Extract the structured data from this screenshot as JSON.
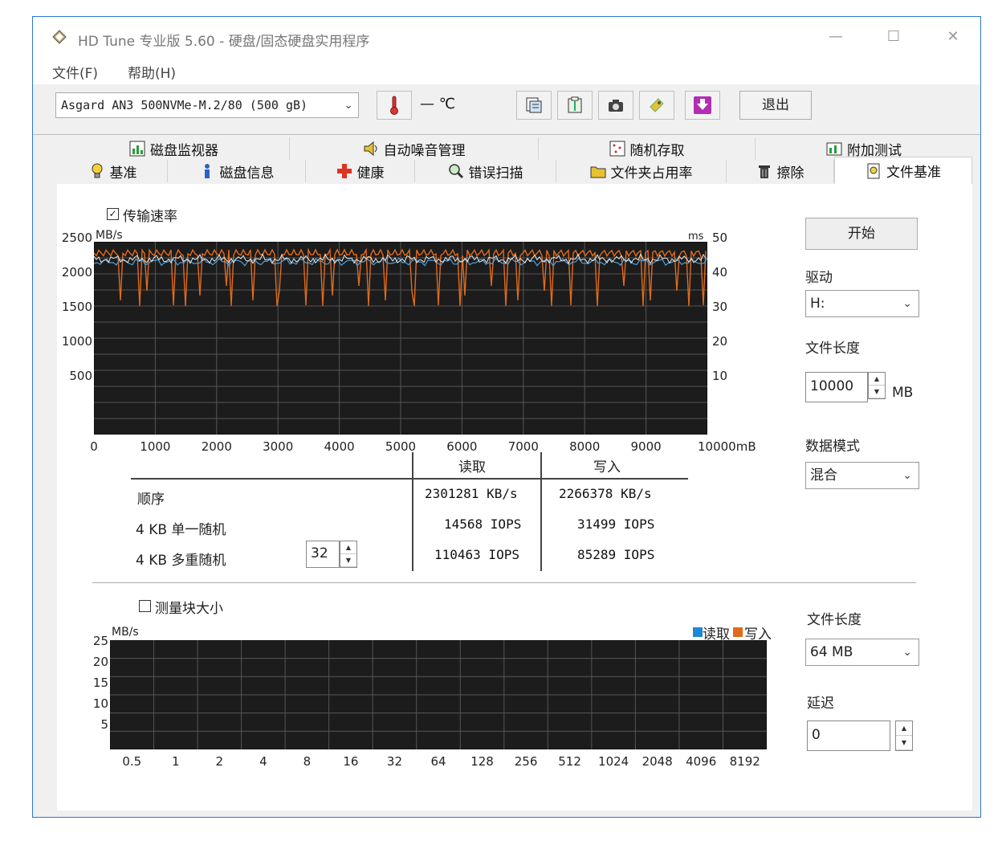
{
  "window": {
    "title": "HD Tune 专业版 5.60 - 硬盘/固态硬盘实用程序",
    "minimize": "—",
    "maximize": "☐",
    "close": "✕"
  },
  "menu": [
    "文件(F)",
    "帮助(H)"
  ],
  "toolbar": {
    "drive": "Asgard AN3 500NVMe-M.2/80 (500 gB)",
    "temperature": "— ℃",
    "exit_label": "退出"
  },
  "tabs_top": [
    "磁盘监视器",
    "自动噪音管理",
    "随机存取",
    "附加测试"
  ],
  "tabs_bottom": [
    "基准",
    "磁盘信息",
    "健康",
    "错误扫描",
    "文件夹占用率",
    "擦除",
    "文件基准"
  ],
  "active_tab": "文件基准",
  "transfer": {
    "checkbox_label": "传输速率",
    "checked_mark": "✓",
    "left_unit": "MB/s",
    "right_unit": "ms",
    "left_ticks": [
      "2500",
      "2000",
      "1500",
      "1000",
      "500"
    ],
    "right_ticks": [
      "50",
      "40",
      "30",
      "20",
      "10"
    ],
    "x_ticks": [
      "0",
      "1000",
      "2000",
      "3000",
      "4000",
      "5000",
      "6000",
      "7000",
      "8000",
      "9000",
      "10000mB"
    ]
  },
  "results": {
    "read_header": "读取",
    "write_header": "写入",
    "rows": [
      {
        "label": "顺序",
        "read": "2301281 KB/s",
        "write": "2266378 KB/s"
      },
      {
        "label": "4 KB 单一随机",
        "read": "14568 IOPS",
        "write": "31499 IOPS"
      },
      {
        "label": "4 KB 多重随机",
        "read": "110463 IOPS",
        "write": "85289 IOPS"
      }
    ],
    "queue_depth": "32"
  },
  "right_panel": {
    "start_label": "开始",
    "drive_label": "驱动",
    "drive_value": "H:",
    "file_length_label": "文件长度",
    "file_length_value": "10000",
    "file_length_unit": "MB",
    "data_mode_label": "数据模式",
    "data_mode_value": "混合"
  },
  "block": {
    "checkbox_label": "测量块大小",
    "unit": "MB/s",
    "legend_read": "读取",
    "legend_write": "写入",
    "y_ticks": [
      "25",
      "20",
      "15",
      "10",
      "5"
    ],
    "x_ticks": [
      "0.5",
      "1",
      "2",
      "4",
      "8",
      "16",
      "32",
      "64",
      "128",
      "256",
      "512",
      "1024",
      "2048",
      "4096",
      "8192"
    ],
    "file_length_label": "文件长度",
    "file_length_value": "64 MB",
    "delay_label": "延迟",
    "delay_value": "0"
  },
  "colors": {
    "read_line": "#4aa0e0",
    "write_line": "#e06a1c",
    "chart_bg": "#1c1c1c",
    "grid": "#555555"
  }
}
